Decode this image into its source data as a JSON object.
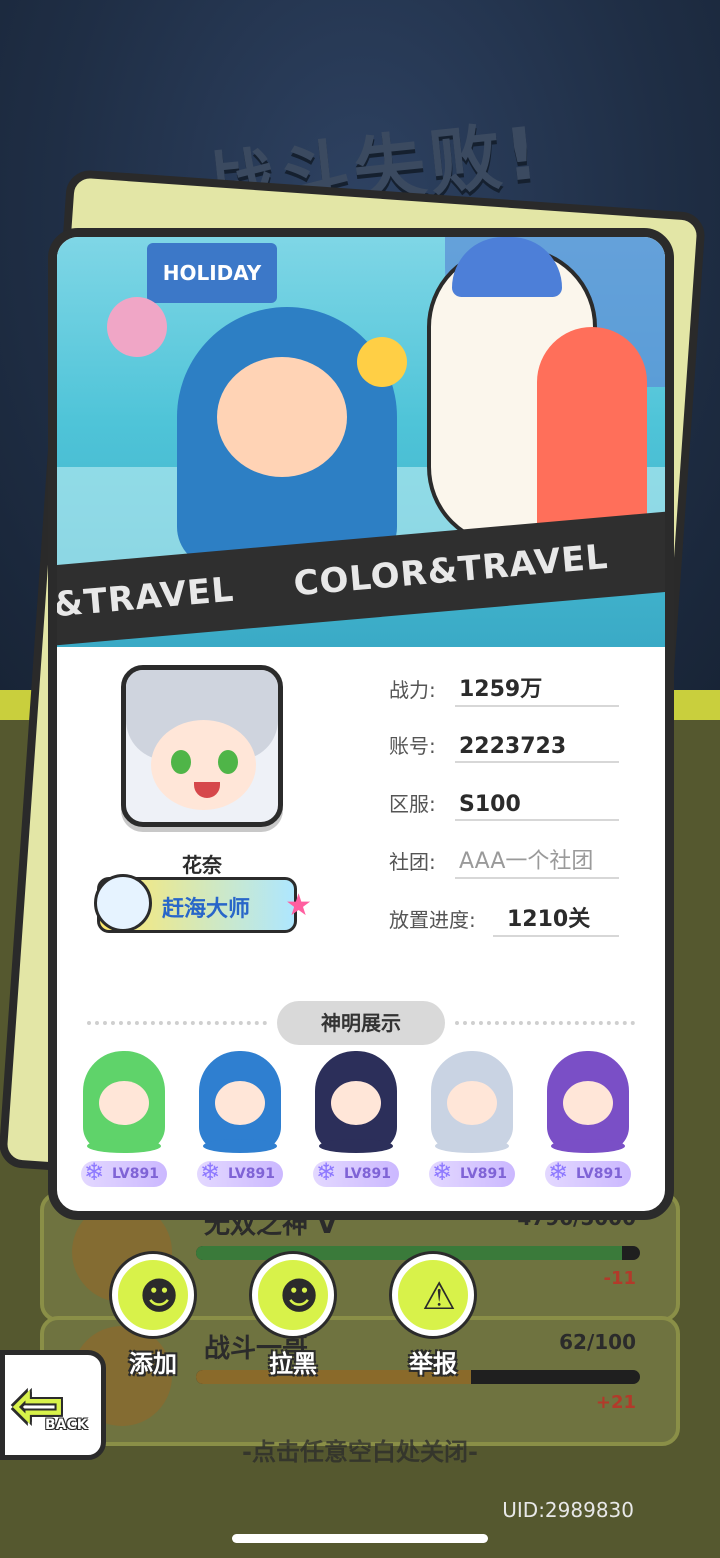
{
  "screen_title": "战斗失败!",
  "background_rows": [
    {
      "title": "无双之神 V",
      "value": "4796/5000",
      "progress": 0.9592,
      "delta": "-11"
    },
    {
      "title": "战斗一哥",
      "value": "62/100",
      "progress": 0.62,
      "delta": "+21"
    }
  ],
  "banner": {
    "sign": "HOLIDAY",
    "stripe_texts": [
      "&TRAVEL",
      "COLOR&TRAVEL",
      "CO"
    ]
  },
  "profile": {
    "name": "花奈",
    "title_badge": "赶海大师",
    "fields": {
      "power": {
        "label": "战力:",
        "value": "1259万"
      },
      "account": {
        "label": "账号:",
        "value": "2223723"
      },
      "server": {
        "label": "区服:",
        "value": "S100"
      },
      "guild": {
        "label": "社团:",
        "value": "AAA一个社团"
      },
      "idle_progress": {
        "label": "放置进度:",
        "value": "1210关"
      }
    }
  },
  "showcase": {
    "title": "神明展示",
    "heroes": [
      {
        "level": "LV891",
        "color": "#5fd36a"
      },
      {
        "level": "LV891",
        "color": "#2f7fd0"
      },
      {
        "level": "LV891",
        "color": "#2c2f5a"
      },
      {
        "level": "LV891",
        "color": "#c9d3e3"
      },
      {
        "level": "LV891",
        "color": "#7a4fc6"
      }
    ]
  },
  "actions": {
    "add": "添加",
    "block": "拉黑",
    "report": "举报"
  },
  "back_label": "BACK",
  "close_hint": "-点击任意空白处关闭-",
  "uid": "UID:2989830",
  "colors": {
    "accent_lime": "#d8f24a",
    "dark_outline": "#2b2b2b",
    "level_purple": "#7f63d6"
  }
}
